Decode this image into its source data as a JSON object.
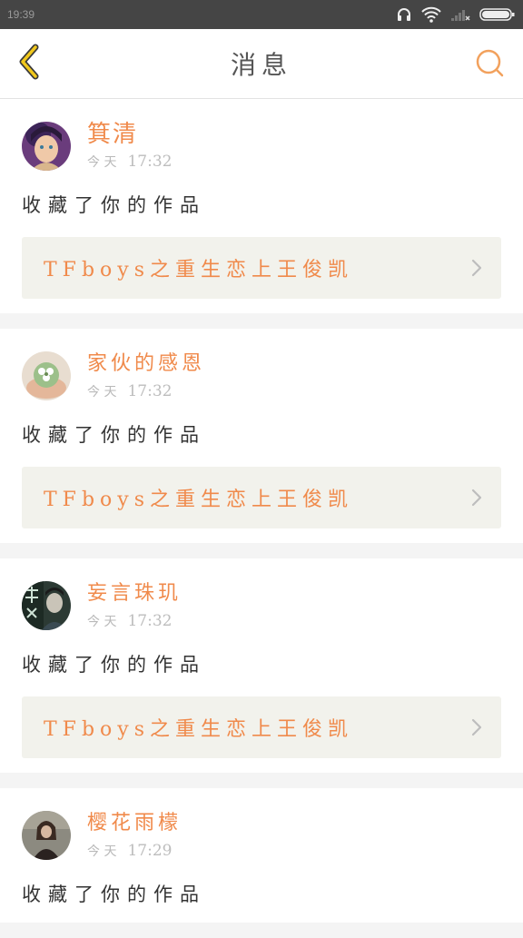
{
  "status_bar": {
    "time": "19:39",
    "icons": [
      "headphones-icon",
      "wifi-icon",
      "signal-icon",
      "battery-icon"
    ]
  },
  "header": {
    "title": "消息",
    "back_icon": "chevron-left-icon",
    "search_icon": "search-icon"
  },
  "colors": {
    "accent": "#f08a4b",
    "back_yellow": "#f1c81c",
    "card_link_bg": "#f2f2ec"
  },
  "messages": [
    {
      "username": "箕清",
      "day": "今 天",
      "time": "17:32",
      "action": "收藏了你的作品",
      "work_title": "TFboys之重生恋上王俊凯"
    },
    {
      "username": "家伙的感恩",
      "day": "今 天",
      "time": "17:32",
      "action": "收藏了你的作品",
      "work_title": "TFboys之重生恋上王俊凯"
    },
    {
      "username": "妄言珠玑",
      "day": "今 天",
      "time": "17:32",
      "action": "收藏了你的作品",
      "work_title": "TFboys之重生恋上王俊凯"
    },
    {
      "username": "樱花雨檬",
      "day": "今 天",
      "time": "17:29",
      "action": "收藏了你的作品",
      "work_title": ""
    }
  ]
}
